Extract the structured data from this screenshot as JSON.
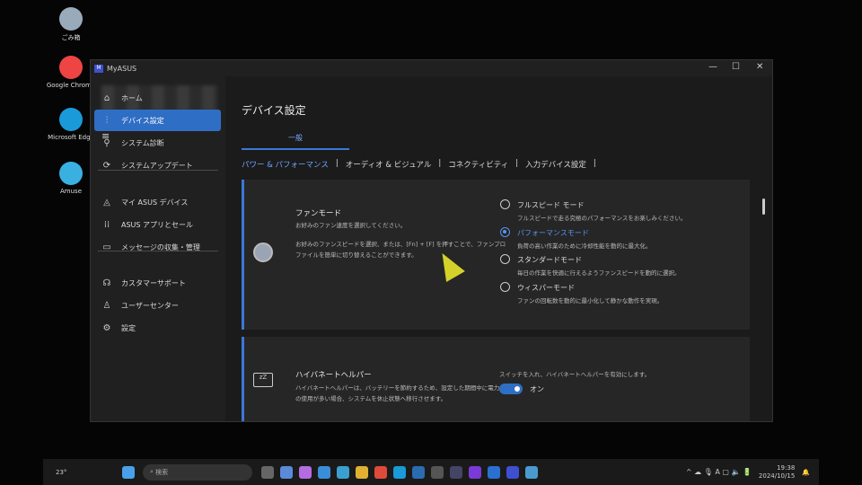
{
  "desktop": {
    "icons": [
      {
        "label": "ごみ箱",
        "color": "#9ab"
      },
      {
        "label": "Google Chrome",
        "color": "#e44"
      },
      {
        "label": "Microsoft Edge",
        "color": "#1a9ad8"
      },
      {
        "label": "Amuse",
        "color": "#3ab0e0"
      }
    ]
  },
  "window": {
    "title": "MyASUS",
    "minimize": "—",
    "maximize": "☐",
    "close": "✕"
  },
  "sidebar": {
    "menu_icon": "≡",
    "items": [
      {
        "icon": "⌂",
        "label": "ホーム"
      },
      {
        "icon": "⫶",
        "label": "デバイス設定",
        "active": true
      },
      {
        "icon": "⚲",
        "label": "システム診断"
      },
      {
        "icon": "⟳",
        "label": "システムアップデート"
      },
      {
        "icon": "◬",
        "label": "マイ ASUS デバイス"
      },
      {
        "icon": "⁞⁞",
        "label": "ASUS アプリとセール"
      },
      {
        "icon": "▭",
        "label": "メッセージの収集・管理"
      },
      {
        "icon": "☊",
        "label": "カスタマーサポート"
      },
      {
        "icon": "♙",
        "label": "ユーザーセンター"
      },
      {
        "icon": "⚙",
        "label": "設定"
      }
    ]
  },
  "main": {
    "title": "デバイス設定",
    "tab": "一般",
    "subtabs": [
      "パワー & パフォーマンス",
      "|",
      "オーディオ & ビジュアル",
      "|",
      "コネクティビティ",
      "|",
      "入力デバイス設定",
      "|"
    ],
    "fan": {
      "title": "ファンモード",
      "desc1": "お好みのファン速度を選択してください。",
      "desc2": "お好みのファンスピードを選択、または、[Fn] + [F] を押すことで、ファンプロ",
      "desc3": "ファイルを簡単に切り替えることができます。",
      "options": [
        {
          "label": "フルスピード モード",
          "desc": "フルスピードで走る究極のパフォーマンスをお楽しみください。",
          "selected": false
        },
        {
          "label": "パフォーマンスモード",
          "desc": "負荷の高い作業のために冷却性能を動的に最大化。",
          "selected": true
        },
        {
          "label": "スタンダードモード",
          "desc": "毎日の作業を快適に行えるようファンスピードを動的に選択。",
          "selected": false
        },
        {
          "label": "ウィスパーモード",
          "desc": "ファンの回転数を動的に最小化して静かな動作を実現。",
          "selected": false
        }
      ]
    },
    "hyper": {
      "title": "ハイバネートヘルパー",
      "desc1": "ハイバネートヘルパーは、バッテリーを節約するため、設定した期間中に電力",
      "desc2": "の使用が多い場合、システムを休止状態へ移行させます。",
      "switch_desc": "スイッチを入れ、ハイバネートヘルパーを有効にします。",
      "switch_label": "オン",
      "icon": "zZ"
    }
  },
  "taskbar": {
    "weather": "23°",
    "search_placeholder": "検索",
    "time": "19:38",
    "date": "2024/10/15",
    "apps": [
      {
        "name": "task-view",
        "color": "#666"
      },
      {
        "name": "settings",
        "color": "#5a8bd8"
      },
      {
        "name": "copilot",
        "color": "#b46de0"
      },
      {
        "name": "photos",
        "color": "#3a8ed8"
      },
      {
        "name": "store",
        "color": "#3aa0d0"
      },
      {
        "name": "explorer",
        "color": "#e0b030"
      },
      {
        "name": "chrome",
        "color": "#e04a3a"
      },
      {
        "name": "edge",
        "color": "#1a9ad8"
      },
      {
        "name": "app",
        "color": "#2b6cb0"
      },
      {
        "name": "obs",
        "color": "#555"
      },
      {
        "name": "davinci",
        "color": "#446"
      },
      {
        "name": "edit",
        "color": "#7a3ad8"
      },
      {
        "name": "outlook",
        "color": "#2a70d0"
      },
      {
        "name": "myasus",
        "color": "#3f4fd1"
      },
      {
        "name": "notepad",
        "color": "#4a9ad0"
      }
    ]
  }
}
